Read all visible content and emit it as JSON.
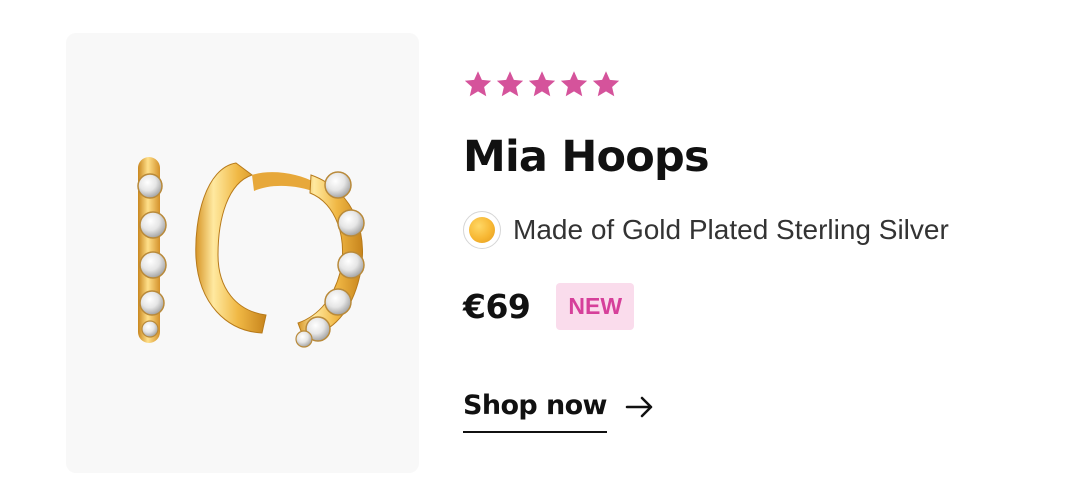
{
  "product": {
    "rating_stars": 5,
    "star_color": "#d5539b",
    "title": "Mia Hoops",
    "material": {
      "label": "Made of Gold Plated Sterling Silver",
      "swatch_color": "#f7b733"
    },
    "price": "€69",
    "badge": "NEW",
    "badge_color": "#d6409a",
    "cta_label": "Shop now",
    "cta_icon": "arrow-right-icon"
  },
  "image": {
    "subject": "gold-hoop-earrings-with-crystals"
  }
}
